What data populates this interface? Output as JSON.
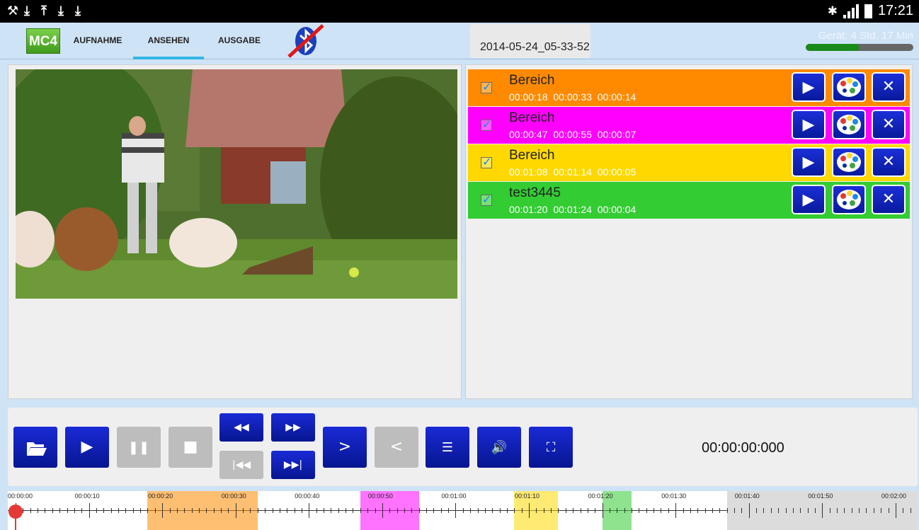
{
  "statusbar": {
    "left_icons": [
      "usb-debug-icon",
      "download-icon",
      "upload-icon",
      "download-icon",
      "download-icon"
    ],
    "time": "17:21"
  },
  "actionbar": {
    "logo": "MC4",
    "tabs": [
      {
        "label": "AUFNAHME",
        "active": false
      },
      {
        "label": "ANSEHEN",
        "active": true
      },
      {
        "label": "AUSGABE",
        "active": false
      }
    ],
    "filename": "2014-05-24_05-33-52",
    "device_text": "Gerät: 4 Std. 17 Min",
    "device_level_percent": 50
  },
  "segments": [
    {
      "name": "Bereich",
      "start": "00:00:18",
      "end": "00:00:33",
      "duration": "00:00:14",
      "color": "#ff8a00"
    },
    {
      "name": "Bereich",
      "start": "00:00:47",
      "end": "00:00:55",
      "duration": "00:00:07",
      "color": "#ff00ff"
    },
    {
      "name": "Bereich",
      "start": "00:01:08",
      "end": "00:01:14",
      "duration": "00:00:05",
      "color": "#ffd800"
    },
    {
      "name": "test3445",
      "start": "00:01:20",
      "end": "00:01:24",
      "duration": "00:00:04",
      "color": "#33cc33"
    }
  ],
  "controls": {
    "timecode": "00:00:00:000"
  },
  "timeline": {
    "labels": [
      "00:00:00",
      "00:00:10",
      "00:00:20",
      "00:00:30",
      "00:00:40",
      "00:00:50",
      "00:01:00",
      "00:01:10",
      "00:01:20",
      "00:01:30",
      "00:01:40",
      "00:01:50",
      "00:02:00"
    ],
    "duration_seconds": 97,
    "visible_seconds": 123,
    "cursor_seconds": 0
  }
}
